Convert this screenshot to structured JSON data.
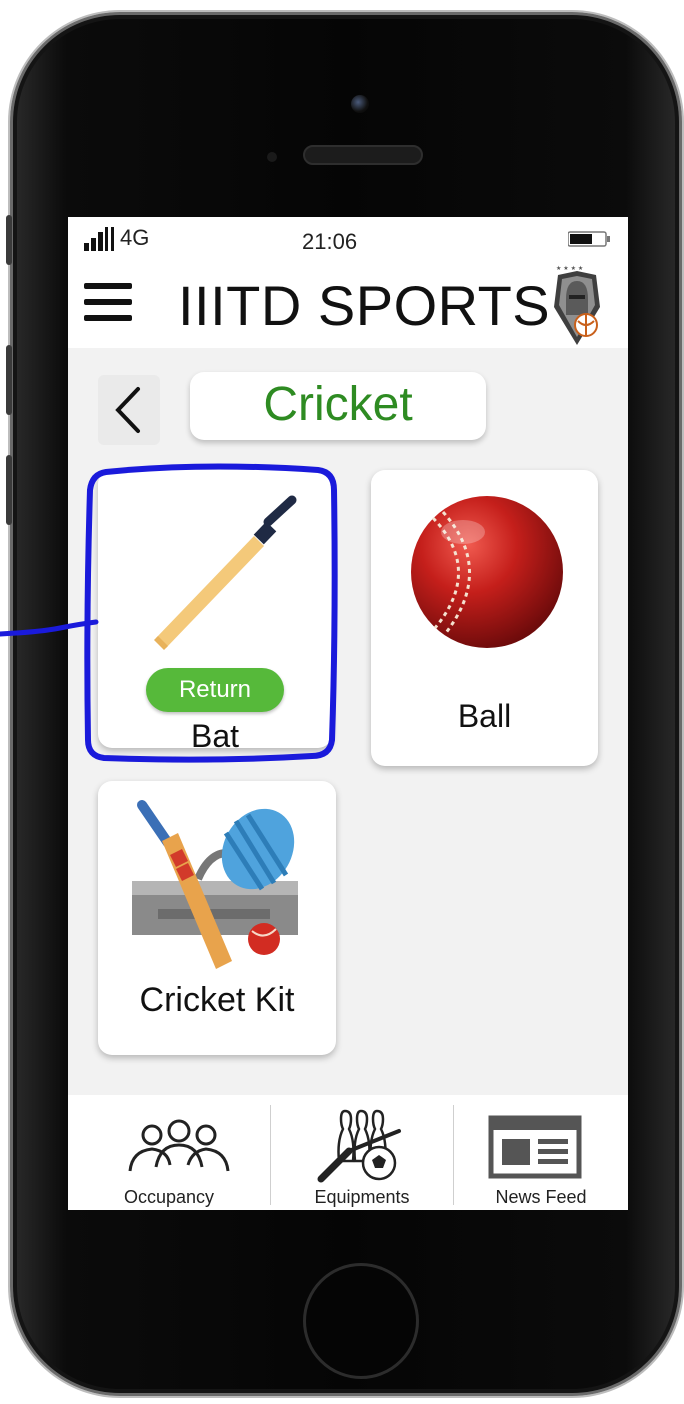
{
  "status_bar": {
    "network": "4G",
    "time": "21:06"
  },
  "app_bar": {
    "title": "IIITD SPORTS"
  },
  "page": {
    "sport_title": "Cricket",
    "title_color": "#2e8b22"
  },
  "equipment_cards": [
    {
      "label": "Bat",
      "action_label": "Return",
      "action_color": "#56b93a",
      "icon": "cricket-bat-icon"
    },
    {
      "label": "Ball",
      "icon": "cricket-ball-icon"
    },
    {
      "label": "Cricket Kit",
      "icon": "cricket-kit-icon"
    }
  ],
  "annotation": {
    "highlight_color": "#1a1adb"
  },
  "bottom_nav": [
    {
      "label": "Occupancy",
      "icon": "people-icon"
    },
    {
      "label": "Equipments",
      "icon": "equipment-icon"
    },
    {
      "label": "News Feed",
      "icon": "newspaper-icon"
    }
  ]
}
